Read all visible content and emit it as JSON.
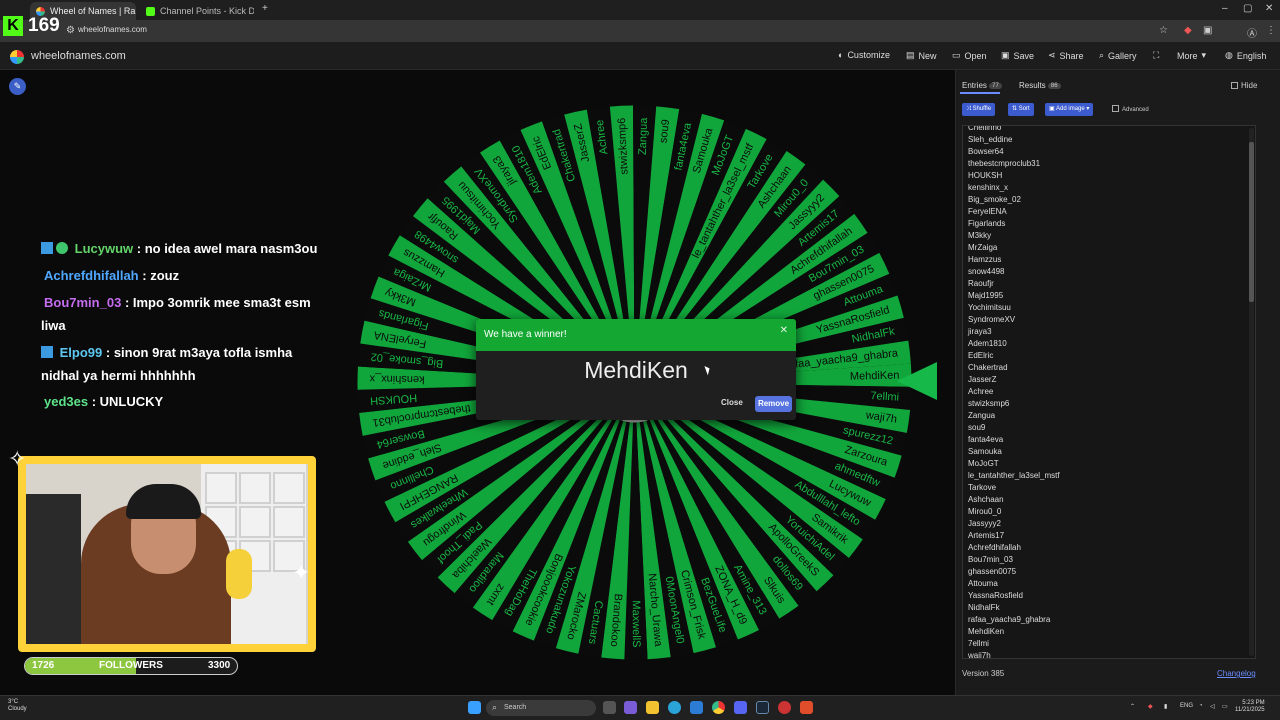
{
  "browser": {
    "tabs": [
      {
        "title": "Wheel of Names | Random",
        "active": true
      },
      {
        "title": "Channel Points - Kick Dashboa",
        "active": false
      }
    ],
    "url": "wheelofnames.com"
  },
  "kick_overlay": {
    "badge": "K",
    "viewer_count": "169"
  },
  "site": {
    "name": "wheelofnames.com",
    "menu": [
      "Customize",
      "New",
      "Open",
      "Save",
      "Share",
      "Gallery",
      "More",
      "English"
    ]
  },
  "chat": [
    {
      "user": "Lucywuw",
      "message": ": no idea awel mara nasm3ou",
      "color": "#63d46a"
    },
    {
      "user": "Achrefdhifallah",
      "message": ": zouz",
      "color": "#4ea8ff"
    },
    {
      "user": "Bou7min_03",
      "message": ": Impo 3omrik mee sma3t esm",
      "message2": "liwa",
      "color": "#c56cf0"
    },
    {
      "user": "Elpo99",
      "message": ": sinon 9rat m3aya tofla ismha",
      "message2": "nidhal ya hermi hhhhhhh",
      "color": "#5ec8f2"
    },
    {
      "user": "yed3es",
      "message": ": UNLUCKY",
      "color": "#5de38a"
    }
  ],
  "followers_bar": {
    "current": "1726",
    "label": "FOLLOWERS",
    "goal": "3300",
    "progress": 0.523,
    "color": "#8dc63f"
  },
  "wheel": {
    "colors": [
      "#11a63b",
      "#0b0b0b"
    ],
    "segments": [
      "MehdiKen",
      "7ellmi",
      "waji7h",
      "spurezz12",
      "Zarzoura",
      "ahmedftw",
      "Lucywuw",
      "Abdulllahl_lefto",
      "Samikrik",
      "YoruichiAdel",
      "ApolloGreekS",
      "dollos69",
      "Slkuis",
      "Amine_313",
      "ZONA_H_d9",
      "BezGueLife",
      "Crimson_Frisk",
      "0MoonAngel0",
      "Narcho_Urawa",
      "MaxwellS",
      "Brandokoo",
      "Cactuars",
      "ZMarocko",
      "Yokozunakudo",
      "Bonjoookcookie",
      "TheHoDag",
      "zxmt",
      "Maradiloo",
      "Waelchiba",
      "Padi_Thoof",
      "Windfrogu",
      "Wheelwalkes",
      "RANGEHFPI",
      "Chellinno",
      "Sleh_eddine",
      "Bowser64",
      "thebestcmproclub31",
      "HOUKSH",
      "kenshinx_x",
      "Big_smoke_02",
      "FeryelENA",
      "Figarlands",
      "M3kky",
      "MrZaiga",
      "Hamzzus",
      "snow4498",
      "Raoufjr",
      "Majd1995",
      "Yochimitsuu",
      "SyndromeXV",
      "jiraya3",
      "Adem1810",
      "EdElric",
      "Chakertrad",
      "JasserZ",
      "Achree",
      "stwizksmp6",
      "Zangua",
      "sou9",
      "fanta4eva",
      "Samouka",
      "MoJoGT",
      "le_tantahther_la3sel_mstf",
      "Tarkove",
      "Ashchaan",
      "Mirou0_0",
      "Jassyyy2",
      "Artemis17",
      "Achrefdhifallah",
      "Bou7min_03",
      "ghassen0075",
      "Attouma",
      "YassnaRosfield",
      "NidhalFk",
      "rafaa_yaacha9_ghabra"
    ]
  },
  "modal": {
    "title": "We have a winner!",
    "winner": "MehdiKen",
    "close_label": "Close",
    "remove_label": "Remove",
    "header_color": "#14a832"
  },
  "panel": {
    "tabs": [
      {
        "label": "Entries",
        "count": "77"
      },
      {
        "label": "Results",
        "count": "86"
      }
    ],
    "hide_label": "Hide",
    "buttons": [
      "Shuffle",
      "Sort",
      "Add image"
    ],
    "advanced_label": "Advanced",
    "entries": [
      "Chellinno",
      "Sleh_eddine",
      "Bowser64",
      "thebestcmproclub31",
      "HOUKSH",
      "kenshinx_x",
      "Big_smoke_02",
      "FeryelENA",
      "Figarlands",
      "M3kky",
      "MrZaiga",
      "Hamzzus",
      "snow4498",
      "Raoufjr",
      "Majd1995",
      "Yochimitsuu",
      "SyndromeXV",
      "jiraya3",
      "Adem1810",
      "EdElric",
      "Chakertrad",
      "JasserZ",
      "Achree",
      "stwizksmp6",
      "Zangua",
      "sou9",
      "fanta4eva",
      "Samouka",
      "MoJoGT",
      "le_tantahther_la3sel_mstf",
      "Tarkove",
      "Ashchaan",
      "Mirou0_0",
      "Jassyyy2",
      "Artemis17",
      "Achrefdhifallah",
      "Bou7min_03",
      "ghassen0075",
      "Attouma",
      "YassnaRosfield",
      "NidhalFk",
      "rafaa_yaacha9_ghabra",
      "MehdiKen",
      "7ellmi",
      "waji7h"
    ],
    "version": "Version 385",
    "changelog": "Changelog"
  },
  "taskbar": {
    "weather_temp": "3°C",
    "weather_desc": "Cloudy",
    "search_placeholder": "Search",
    "lang": "ENG",
    "time": "5:23 PM",
    "date": "11/21/2025"
  }
}
